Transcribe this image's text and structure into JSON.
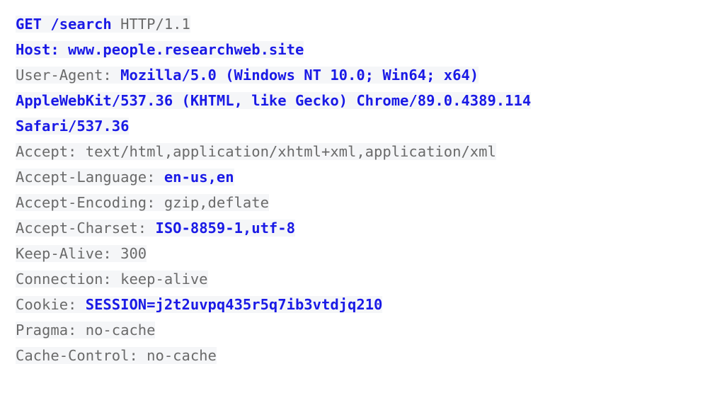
{
  "colors": {
    "background": "#ffffff",
    "line_highlight": "#f5f6f8",
    "plain_text": "#6a6a6a",
    "emphasis_text": "#1a1ae6"
  },
  "request": {
    "method": "GET",
    "path": "/search",
    "protocol": "HTTP/1.1",
    "host": "www.people.researchweb.site",
    "user_agent": "Mozilla/5.0 (Windows NT 10.0; Win64; x64) AppleWebKit/537.36 (KHTML, like Gecko) Chrome/89.0.4389.114 Safari/537.36",
    "accept": "text/html,application/xhtml+xml,application/xml",
    "accept_language": "en-us,en",
    "accept_encoding": "gzip,deflate",
    "accept_charset": "ISO-8859-1,utf-8",
    "keep_alive": "300",
    "connection": "keep-alive",
    "cookie": "SESSION=j2t2uvpq435r5q7ib3vtdjq210",
    "pragma": "no-cache",
    "cache_control": "no-cache"
  },
  "lines": [
    {
      "id": "request-line",
      "tokens": [
        {
          "text": "GET /search",
          "style": "em"
        },
        {
          "text": " HTTP/1.1",
          "style": "plain"
        }
      ]
    },
    {
      "id": "header-host",
      "tokens": [
        {
          "text": "Host: www.people.researchweb.site",
          "style": "em"
        }
      ]
    },
    {
      "id": "header-user-agent",
      "tokens": [
        {
          "text": "User-Agent: ",
          "style": "plain"
        },
        {
          "text": "Mozilla/5.0 (Windows NT 10.0; Win64; x64)",
          "style": "em"
        }
      ]
    },
    {
      "id": "header-user-agent-cont-1",
      "tokens": [
        {
          "text": "AppleWebKit/537.36 (KHTML, like Gecko) Chrome/89.0.4389.114",
          "style": "em"
        }
      ]
    },
    {
      "id": "header-user-agent-cont-2",
      "tokens": [
        {
          "text": "Safari/537.36",
          "style": "em"
        }
      ]
    },
    {
      "id": "header-accept",
      "tokens": [
        {
          "text": "Accept: text/html,application/xhtml+xml,application/xml",
          "style": "plain"
        }
      ]
    },
    {
      "id": "header-accept-language",
      "tokens": [
        {
          "text": "Accept-Language: ",
          "style": "plain"
        },
        {
          "text": "en-us,en",
          "style": "em"
        }
      ]
    },
    {
      "id": "header-accept-encoding",
      "tokens": [
        {
          "text": "Accept-Encoding: gzip,deflate",
          "style": "plain"
        }
      ]
    },
    {
      "id": "header-accept-charset",
      "tokens": [
        {
          "text": "Accept-Charset: ",
          "style": "plain"
        },
        {
          "text": "ISO-8859-1,utf-8",
          "style": "em"
        }
      ]
    },
    {
      "id": "header-keep-alive",
      "tokens": [
        {
          "text": "Keep-Alive: 300",
          "style": "plain"
        }
      ]
    },
    {
      "id": "header-connection",
      "tokens": [
        {
          "text": "Connection: keep-alive",
          "style": "plain"
        }
      ]
    },
    {
      "id": "header-cookie",
      "tokens": [
        {
          "text": "Cookie: ",
          "style": "plain"
        },
        {
          "text": "SESSION=j2t2uvpq435r5q7ib3vtdjq210",
          "style": "em"
        }
      ]
    },
    {
      "id": "header-pragma",
      "tokens": [
        {
          "text": "Pragma: no-cache",
          "style": "plain"
        }
      ]
    },
    {
      "id": "header-cache-control",
      "tokens": [
        {
          "text": "Cache-Control: no-cache",
          "style": "plain"
        }
      ]
    }
  ]
}
